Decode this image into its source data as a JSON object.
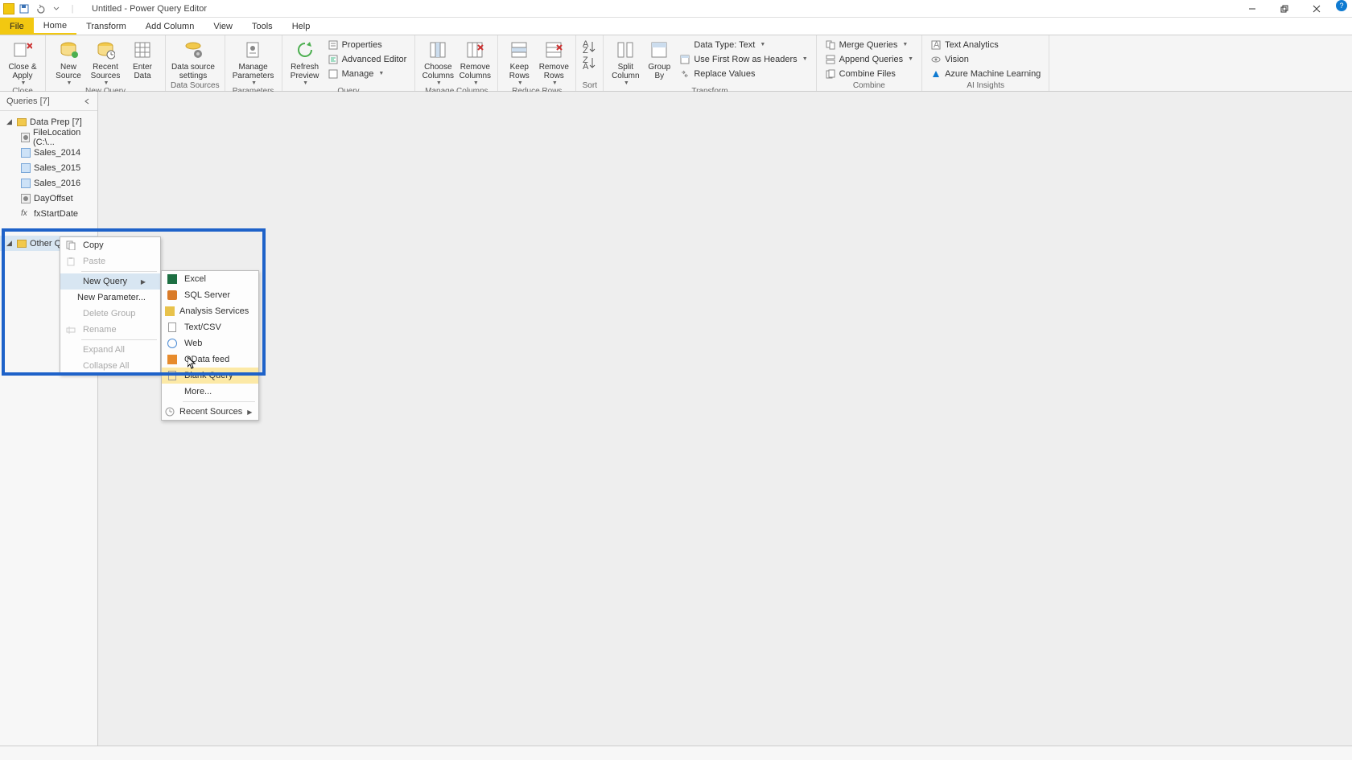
{
  "title": "Untitled - Power Query Editor",
  "window_controls": {
    "min": "minimize",
    "max": "restore",
    "close": "close",
    "help": "?"
  },
  "menu_tabs": {
    "file": "File",
    "home": "Home",
    "transform": "Transform",
    "add_column": "Add Column",
    "view": "View",
    "tools": "Tools",
    "help": "Help"
  },
  "ribbon": {
    "close_apply": "Close &\nApply",
    "new_source": "New\nSource",
    "recent_sources": "Recent\nSources",
    "enter_data": "Enter\nData",
    "data_source_settings": "Data source\nsettings",
    "manage_parameters": "Manage\nParameters",
    "refresh_preview": "Refresh\nPreview",
    "properties": "Properties",
    "advanced_editor": "Advanced Editor",
    "manage": "Manage",
    "choose_columns": "Choose\nColumns",
    "remove_columns": "Remove\nColumns",
    "keep_rows": "Keep\nRows",
    "remove_rows": "Remove\nRows",
    "sort_asc": "sort-asc",
    "sort_desc": "sort-desc",
    "split_column": "Split\nColumn",
    "group_by": "Group\nBy",
    "data_type": "Data Type: Text",
    "first_row_headers": "Use First Row as Headers",
    "replace_values": "Replace Values",
    "merge_queries": "Merge Queries",
    "append_queries": "Append Queries",
    "combine_files": "Combine Files",
    "text_analytics": "Text Analytics",
    "vision": "Vision",
    "azure_ml": "Azure Machine Learning",
    "group_labels": {
      "close": "Close",
      "new_query": "New Query",
      "data_sources": "Data Sources",
      "parameters": "Parameters",
      "query": "Query",
      "manage_columns": "Manage Columns",
      "reduce_rows": "Reduce Rows",
      "sort": "Sort",
      "transform": "Transform",
      "combine": "Combine",
      "ai": "AI Insights"
    }
  },
  "queries_pane": {
    "header": "Queries [7]",
    "folder": "Data Prep [7]",
    "items": [
      "FileLocation (C:\\...",
      "Sales_2014",
      "Sales_2015",
      "Sales_2016",
      "DayOffset",
      "fxStartDate"
    ],
    "other": "Other Q"
  },
  "context_menu": {
    "copy": "Copy",
    "paste": "Paste",
    "new_query": "New Query",
    "new_parameter": "New Parameter...",
    "delete_group": "Delete Group",
    "rename": "Rename",
    "expand_all": "Expand All",
    "collapse_all": "Collapse All"
  },
  "submenu": {
    "excel": "Excel",
    "sql": "SQL Server",
    "analysis": "Analysis Services",
    "textcsv": "Text/CSV",
    "web": "Web",
    "odata": "OData feed",
    "blank": "Blank Query",
    "more": "More...",
    "recent": "Recent Sources"
  }
}
